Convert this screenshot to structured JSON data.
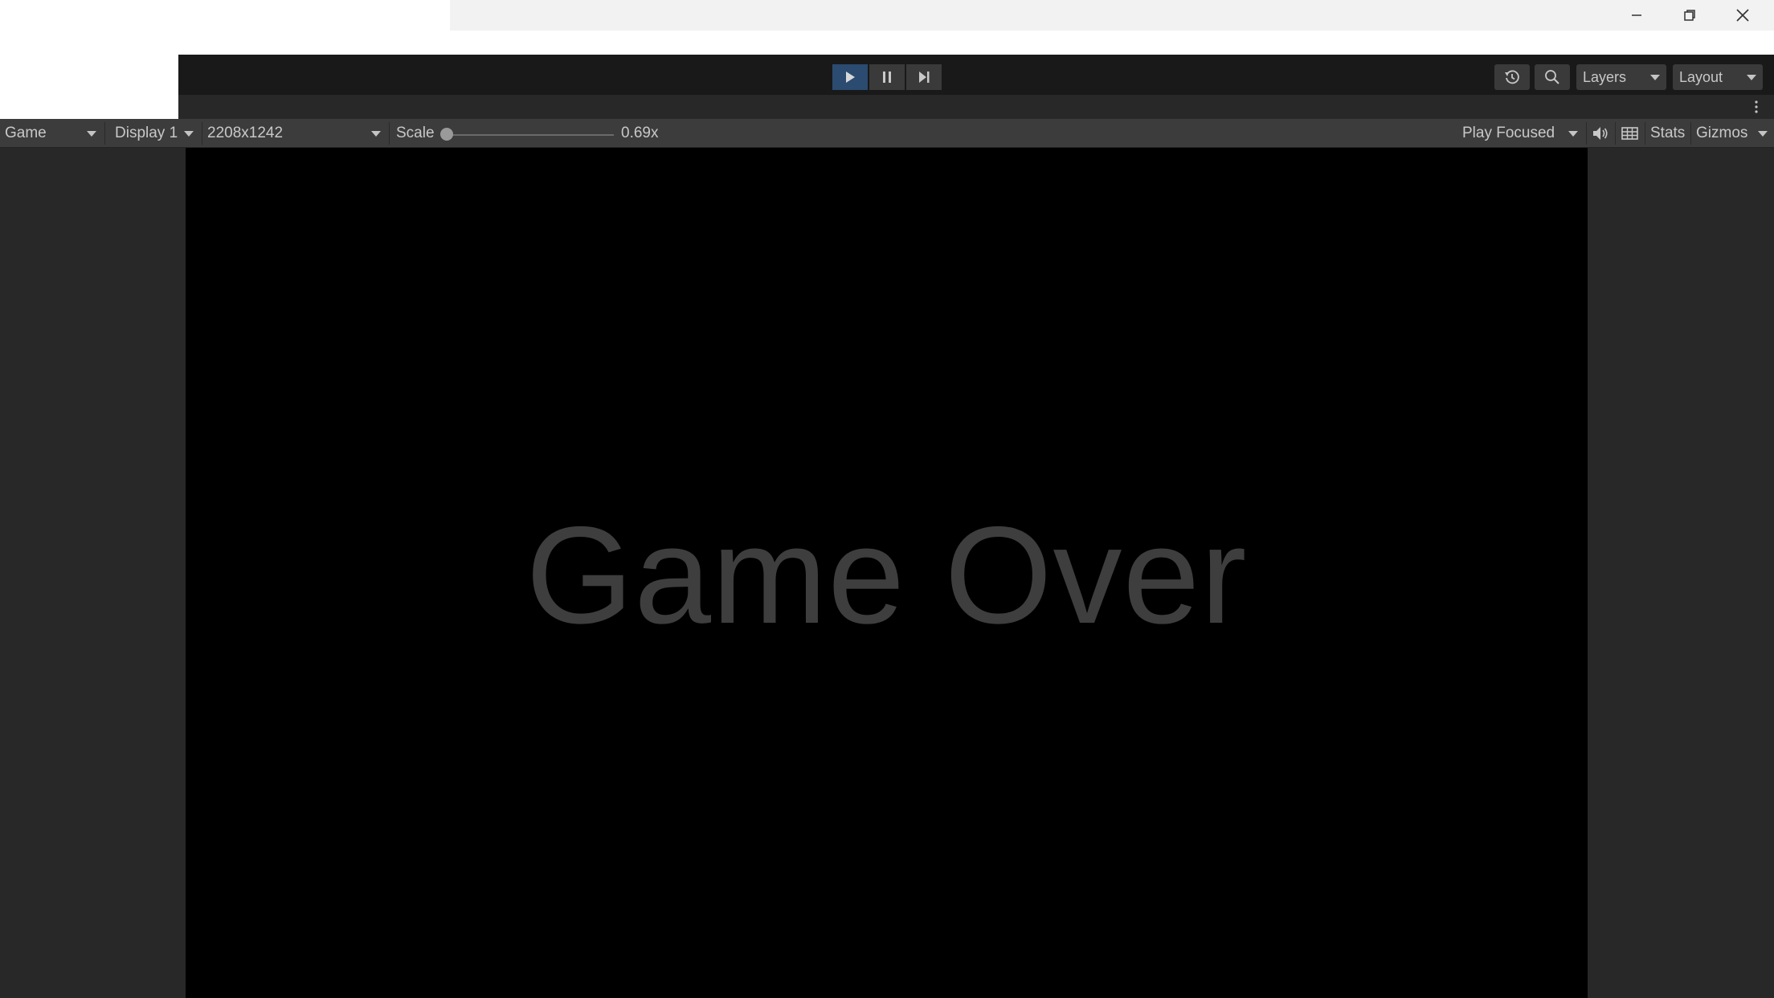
{
  "toolbar": {
    "layers_label": "Layers",
    "layout_label": "Layout",
    "icons": {
      "play": "play-icon",
      "pause": "pause-icon",
      "step": "step-icon",
      "history": "history-icon",
      "search": "search-icon"
    }
  },
  "game_toolbar": {
    "view_select": "Game",
    "display_select": "Display 1",
    "resolution_select": "2208x1242",
    "scale_label": "Scale",
    "scale_value": "0.69x",
    "scale_level": 0.0,
    "play_mode_select": "Play Focused",
    "stats_label": "Stats",
    "gizmos_label": "Gizmos"
  },
  "game_view": {
    "text": "Game Over"
  },
  "colors": {
    "play_active": "#2b4b70",
    "viewport_bg": "#000000",
    "game_text": "#3e3e3e"
  }
}
